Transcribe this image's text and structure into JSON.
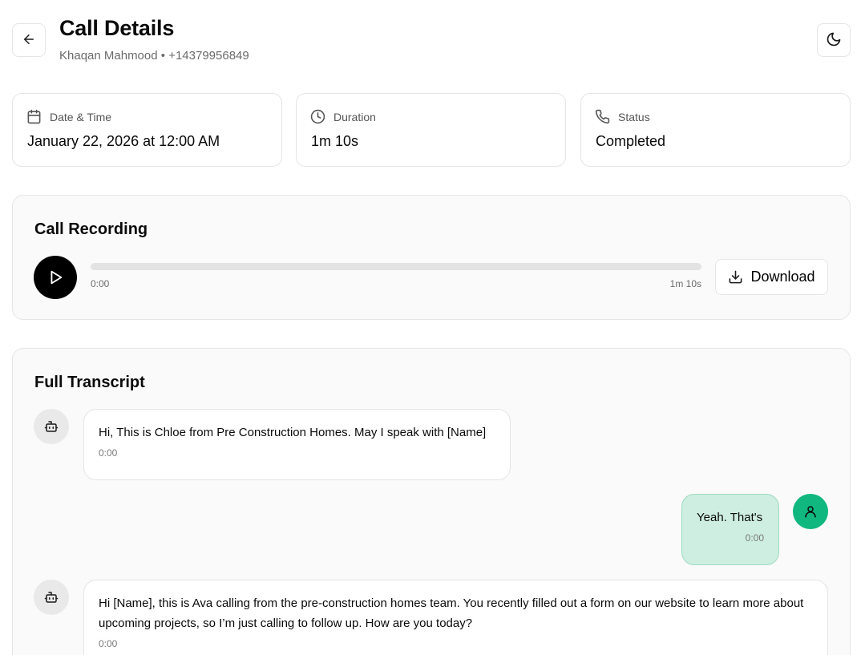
{
  "header": {
    "title": "Call Details",
    "contact_name": "Khaqan Mahmood",
    "separator": "•",
    "phone": "+14379956849",
    "back_icon": "arrow-left-icon",
    "theme_icon": "moon-icon"
  },
  "stats": [
    {
      "label": "Date & Time",
      "value": "January 22, 2026 at 12:00 AM",
      "icon": "calendar-icon"
    },
    {
      "label": "Duration",
      "value": "1m 10s",
      "icon": "clock-icon"
    },
    {
      "label": "Status",
      "value": "Completed",
      "icon": "phone-icon"
    }
  ],
  "recording": {
    "title": "Call Recording",
    "current_time": "0:00",
    "total_time": "1m 10s",
    "progress": 0,
    "download_label": "Download",
    "play_icon": "play-icon",
    "download_icon": "download-icon"
  },
  "transcript": {
    "title": "Full Transcript",
    "messages": [
      {
        "role": "bot",
        "text": "Hi, This is Chloe from Pre Construction Homes. May I speak with [Name]",
        "time": "0:00",
        "icon": "bot-icon"
      },
      {
        "role": "user",
        "text": "Yeah. That's",
        "time": "0:00",
        "icon": "user-icon"
      },
      {
        "role": "bot",
        "text": "Hi [Name], this is Ava calling from the pre-construction homes team. You recently filled out a form on our website to learn more about upcoming projects, so I’m just calling to follow up. How are you today?",
        "time": "0:00",
        "icon": "bot-icon"
      }
    ]
  },
  "colors": {
    "accent_user": "#10b77f",
    "user_bubble": "#cdeee0",
    "play_button": "#000000"
  }
}
